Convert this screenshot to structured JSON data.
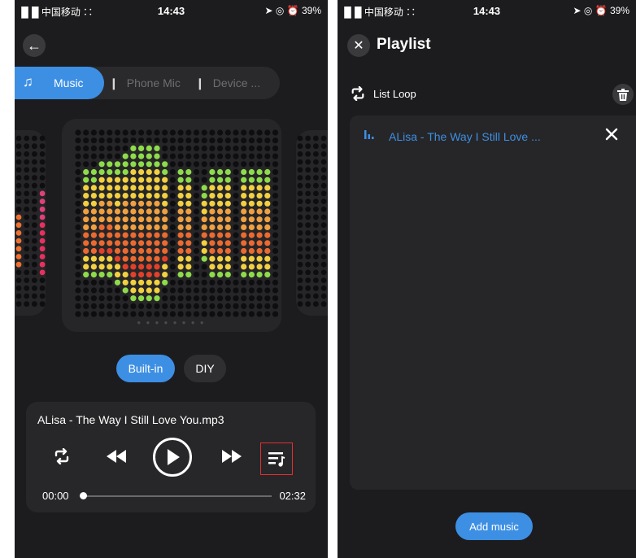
{
  "left": {
    "status": {
      "carrier": "▐▌█ 中国移动 ∷",
      "time": "14:43",
      "right": "➤ ◎ ⏰ 39%"
    },
    "back_icon": "←",
    "tabs": {
      "music": {
        "icon": "♫",
        "label": "Music"
      },
      "phone_mic": {
        "icon": "❙",
        "label": "Phone Mic"
      },
      "device": {
        "icon": "❙",
        "label": "Device ..."
      }
    },
    "page_dots": "● ● ● ● ● ● ● ●",
    "modes": {
      "builtin": "Built-in",
      "diy": "DIY"
    },
    "player": {
      "song": "ALisa - The Way I Still Love You.mp3",
      "time_current": "00:00",
      "time_total": "02:32",
      "progress": 0
    }
  },
  "right": {
    "status": {
      "carrier": "▐▌█ 中国移动 ∷",
      "time": "14:43",
      "right": "➤ ◎ ⏰ 39%"
    },
    "close_icon": "✕",
    "title": "Playlist",
    "loop_label": "List Loop",
    "items": [
      {
        "title": "ALisa - The Way I Still Love ..."
      }
    ],
    "add_music": "Add music"
  },
  "colors": {
    "accent": "#3d8fe4",
    "background": "#1c1c1e",
    "card": "#262628",
    "highlight_box": "#e03030"
  }
}
